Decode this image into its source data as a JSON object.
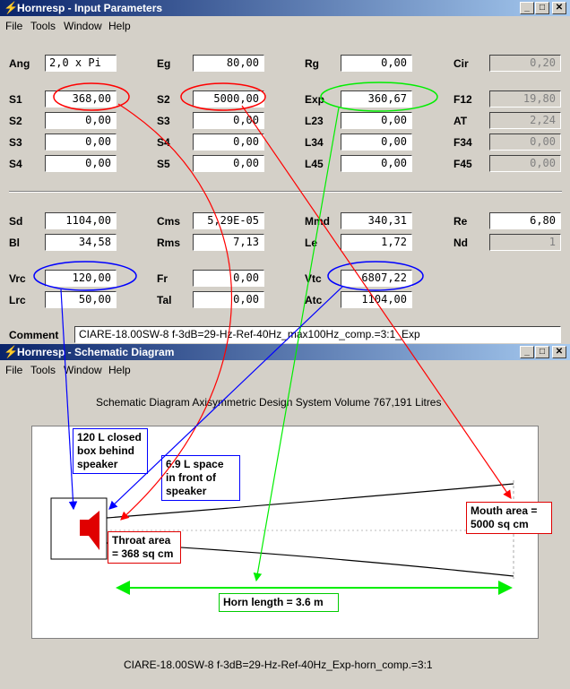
{
  "window1": {
    "title": "Hornresp - Input Parameters",
    "menu": [
      "File",
      "Tools",
      "Window",
      "Help"
    ],
    "rows_top": [
      [
        {
          "label": "Ang",
          "value": "2,0 x Pi"
        },
        {
          "label": "Eg",
          "value": "80,00"
        },
        {
          "label": "Rg",
          "value": "0,00"
        },
        {
          "label": "Cir",
          "value": "0,20"
        }
      ],
      [
        {
          "label": "S1",
          "value": "368,00"
        },
        {
          "label": "S2",
          "value": "5000,00"
        },
        {
          "label": "Exp",
          "value": "360,67"
        },
        {
          "label": "F12",
          "value": "19,80"
        }
      ],
      [
        {
          "label": "S2",
          "value": "0,00"
        },
        {
          "label": "S3",
          "value": "0,00"
        },
        {
          "label": "L23",
          "value": "0,00"
        },
        {
          "label": "AT",
          "value": "2,24"
        }
      ],
      [
        {
          "label": "S3",
          "value": "0,00"
        },
        {
          "label": "S4",
          "value": "0,00"
        },
        {
          "label": "L34",
          "value": "0,00"
        },
        {
          "label": "F34",
          "value": "0,00"
        }
      ],
      [
        {
          "label": "S4",
          "value": "0,00"
        },
        {
          "label": "S5",
          "value": "0,00"
        },
        {
          "label": "L45",
          "value": "0,00"
        },
        {
          "label": "F45",
          "value": "0,00"
        }
      ]
    ],
    "rows_bottom": [
      [
        {
          "label": "Sd",
          "value": "1104,00"
        },
        {
          "label": "Cms",
          "value": "5,29E-05"
        },
        {
          "label": "Mmd",
          "value": "340,31"
        },
        {
          "label": "Re",
          "value": "6,80"
        }
      ],
      [
        {
          "label": "Bl",
          "value": "34,58"
        },
        {
          "label": "Rms",
          "value": "7,13"
        },
        {
          "label": "Le",
          "value": "1,72"
        },
        {
          "label": "Nd",
          "value": "1"
        }
      ],
      [
        {
          "label": "Vrc",
          "value": "120,00"
        },
        {
          "label": "Fr",
          "value": "0,00"
        },
        {
          "label": "Vtc",
          "value": "6807,22"
        }
      ],
      [
        {
          "label": "Lrc",
          "value": "50,00"
        },
        {
          "label": "Tal",
          "value": "0,00"
        },
        {
          "label": "Atc",
          "value": "1104,00"
        }
      ]
    ],
    "comment_label": "Comment",
    "comment": "CIARE-18.00SW-8 f-3dB=29-Hz-Ref-40Hz_max100Hz_comp.=3:1_Exp"
  },
  "window2": {
    "title": "Hornresp - Schematic Diagram",
    "menu": [
      "File",
      "Tools",
      "Window",
      "Help"
    ],
    "heading": "Schematic Diagram   Axisymmetric Design   System Volume 767,191 Litres",
    "caption": "CIARE-18.00SW-8 f-3dB=29-Hz-Ref-40Hz_Exp-horn_comp.=3:1",
    "callouts": {
      "closed_box": "120 L closed box behind speaker",
      "front_space": "6.9 L space in front of speaker",
      "throat": "Throat area = 368 sq cm",
      "mouth": "Mouth area = 5000 sq cm",
      "length": "Horn length = 3.6 m"
    }
  },
  "colors": {
    "titlebar": "#0a246a",
    "red": "#ff0000",
    "green": "#00ee00",
    "blue": "#0000ff"
  }
}
